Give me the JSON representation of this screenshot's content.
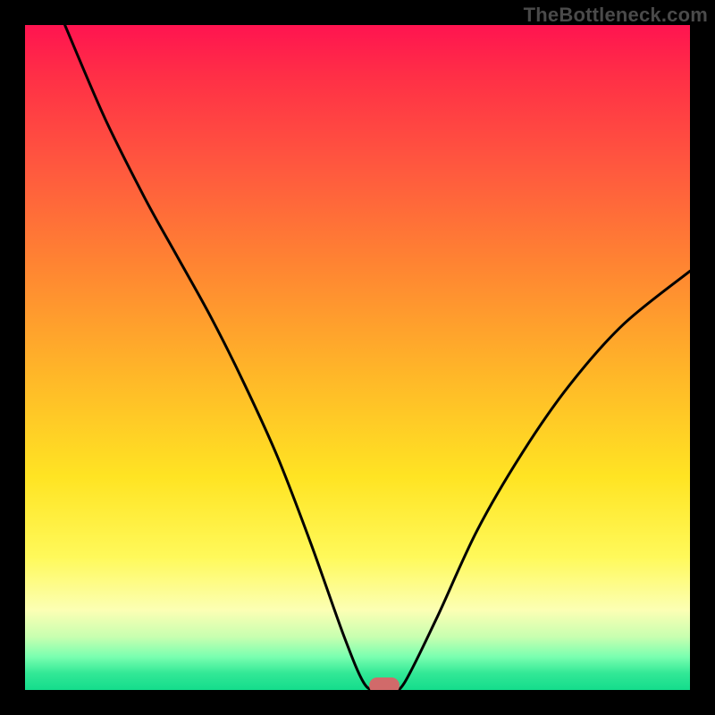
{
  "watermark": "TheBottleneck.com",
  "chart_data": {
    "type": "line",
    "title": "",
    "xlabel": "",
    "ylabel": "",
    "x_range": [
      0,
      100
    ],
    "y_range": [
      0,
      100
    ],
    "series": [
      {
        "name": "curve",
        "points": [
          {
            "x": 6,
            "y": 100
          },
          {
            "x": 12,
            "y": 86
          },
          {
            "x": 18,
            "y": 74
          },
          {
            "x": 23,
            "y": 65
          },
          {
            "x": 28,
            "y": 56
          },
          {
            "x": 33,
            "y": 46
          },
          {
            "x": 38,
            "y": 35
          },
          {
            "x": 43,
            "y": 22
          },
          {
            "x": 48,
            "y": 8
          },
          {
            "x": 51,
            "y": 1
          },
          {
            "x": 53,
            "y": 0
          },
          {
            "x": 55,
            "y": 0
          },
          {
            "x": 57,
            "y": 1
          },
          {
            "x": 62,
            "y": 11
          },
          {
            "x": 68,
            "y": 24
          },
          {
            "x": 75,
            "y": 36
          },
          {
            "x": 82,
            "y": 46
          },
          {
            "x": 90,
            "y": 55
          },
          {
            "x": 100,
            "y": 63
          }
        ]
      }
    ],
    "marker": {
      "x": 54,
      "y": 0.7
    },
    "gradient_stops": [
      {
        "pos": 0.0,
        "color": "#ff1450"
      },
      {
        "pos": 0.08,
        "color": "#ff3046"
      },
      {
        "pos": 0.22,
        "color": "#ff5a3e"
      },
      {
        "pos": 0.36,
        "color": "#ff8432"
      },
      {
        "pos": 0.53,
        "color": "#ffb828"
      },
      {
        "pos": 0.68,
        "color": "#ffe423"
      },
      {
        "pos": 0.8,
        "color": "#fff95a"
      },
      {
        "pos": 0.88,
        "color": "#fcffb4"
      },
      {
        "pos": 0.92,
        "color": "#c8ffb0"
      },
      {
        "pos": 0.95,
        "color": "#7affb0"
      },
      {
        "pos": 0.975,
        "color": "#32e896"
      },
      {
        "pos": 1.0,
        "color": "#14dc8c"
      }
    ]
  }
}
